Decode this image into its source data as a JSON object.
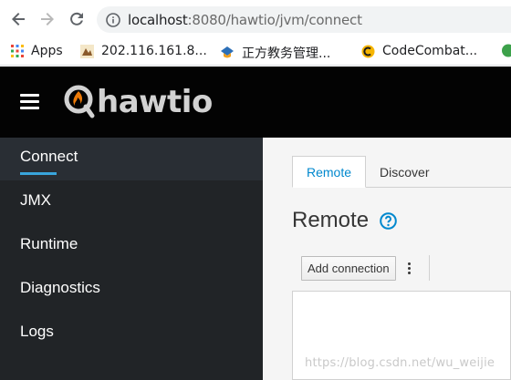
{
  "browser": {
    "url_host": "localhost",
    "url_rest": ":8080/hawtio/jvm/connect",
    "back_icon": "arrow-left-icon",
    "forward_icon": "arrow-right-icon",
    "reload_icon": "reload-icon",
    "info_icon": "info-circle-icon"
  },
  "bookmarks": [
    {
      "label": "Apps",
      "icon": "apps-grid-icon"
    },
    {
      "label": "202.116.161.8...",
      "icon": "site-favicon"
    },
    {
      "label": "正方教务管理...",
      "icon": "edu-favicon"
    },
    {
      "label": "CodeCombat...",
      "icon": "codecombat-favicon"
    }
  ],
  "header": {
    "logo_text": "hawtio",
    "menu_icon": "hamburger-menu-icon",
    "bg_color": "#030303"
  },
  "sidebar": {
    "items": [
      {
        "label": "Connect",
        "active": true
      },
      {
        "label": "JMX",
        "active": false
      },
      {
        "label": "Runtime",
        "active": false
      },
      {
        "label": "Diagnostics",
        "active": false
      },
      {
        "label": "Logs",
        "active": false
      }
    ],
    "accent": "#39a5dc"
  },
  "main": {
    "tabs": [
      {
        "label": "Remote",
        "active": true
      },
      {
        "label": "Discover",
        "active": false
      }
    ],
    "title": "Remote",
    "help_icon": "question-circle-icon",
    "add_button_label": "Add connection",
    "kebab_icon": "kebab-menu-icon"
  },
  "watermark": "https://blog.csdn.net/wu_weijie"
}
